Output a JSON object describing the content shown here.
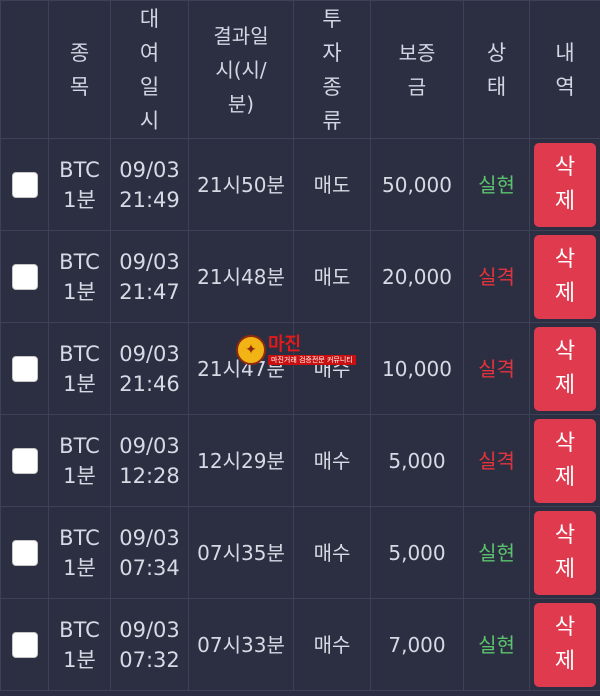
{
  "headers": {
    "item": [
      "종",
      "목"
    ],
    "entry_time": [
      "대",
      "여",
      "일",
      "시"
    ],
    "result_time": [
      "결과일",
      "시(시/",
      "분)"
    ],
    "trade_type": [
      "투",
      "자",
      "종",
      "류"
    ],
    "deposit": [
      "보증",
      "금"
    ],
    "status": [
      "상",
      "태"
    ],
    "history": [
      "내",
      "역"
    ]
  },
  "rows": [
    {
      "item": [
        "BTC",
        "1분"
      ],
      "entry": [
        "09/03",
        "21:49"
      ],
      "result": "21시50분",
      "type": "매도",
      "deposit": "50,000",
      "status": "실현",
      "status_kind": "win",
      "delete": [
        "삭",
        "제"
      ]
    },
    {
      "item": [
        "BTC",
        "1분"
      ],
      "entry": [
        "09/03",
        "21:47"
      ],
      "result": "21시48분",
      "type": "매도",
      "deposit": "20,000",
      "status": "실격",
      "status_kind": "lose",
      "delete": [
        "삭",
        "제"
      ]
    },
    {
      "item": [
        "BTC",
        "1분"
      ],
      "entry": [
        "09/03",
        "21:46"
      ],
      "result": "21시47분",
      "type": "매수",
      "deposit": "10,000",
      "status": "실격",
      "status_kind": "lose",
      "delete": [
        "삭",
        "제"
      ]
    },
    {
      "item": [
        "BTC",
        "1분"
      ],
      "entry": [
        "09/03",
        "12:28"
      ],
      "result": "12시29분",
      "type": "매수",
      "deposit": "5,000",
      "status": "실격",
      "status_kind": "lose",
      "delete": [
        "삭",
        "제"
      ]
    },
    {
      "item": [
        "BTC",
        "1분"
      ],
      "entry": [
        "09/03",
        "07:34"
      ],
      "result": "07시35분",
      "type": "매수",
      "deposit": "5,000",
      "status": "실현",
      "status_kind": "win",
      "delete": [
        "삭",
        "제"
      ]
    },
    {
      "item": [
        "BTC",
        "1분"
      ],
      "entry": [
        "09/03",
        "07:32"
      ],
      "result": "07시33분",
      "type": "매수",
      "deposit": "7,000",
      "status": "실현",
      "status_kind": "win",
      "delete": [
        "삭",
        "제"
      ]
    }
  ],
  "watermark": {
    "main": "마진",
    "sub": "마진거래 검증전문 커뮤니티"
  },
  "colors": {
    "background": "#2b2f41",
    "win": "#5cc36d",
    "lose": "#e5333d",
    "delete_button": "#e03a4e"
  }
}
